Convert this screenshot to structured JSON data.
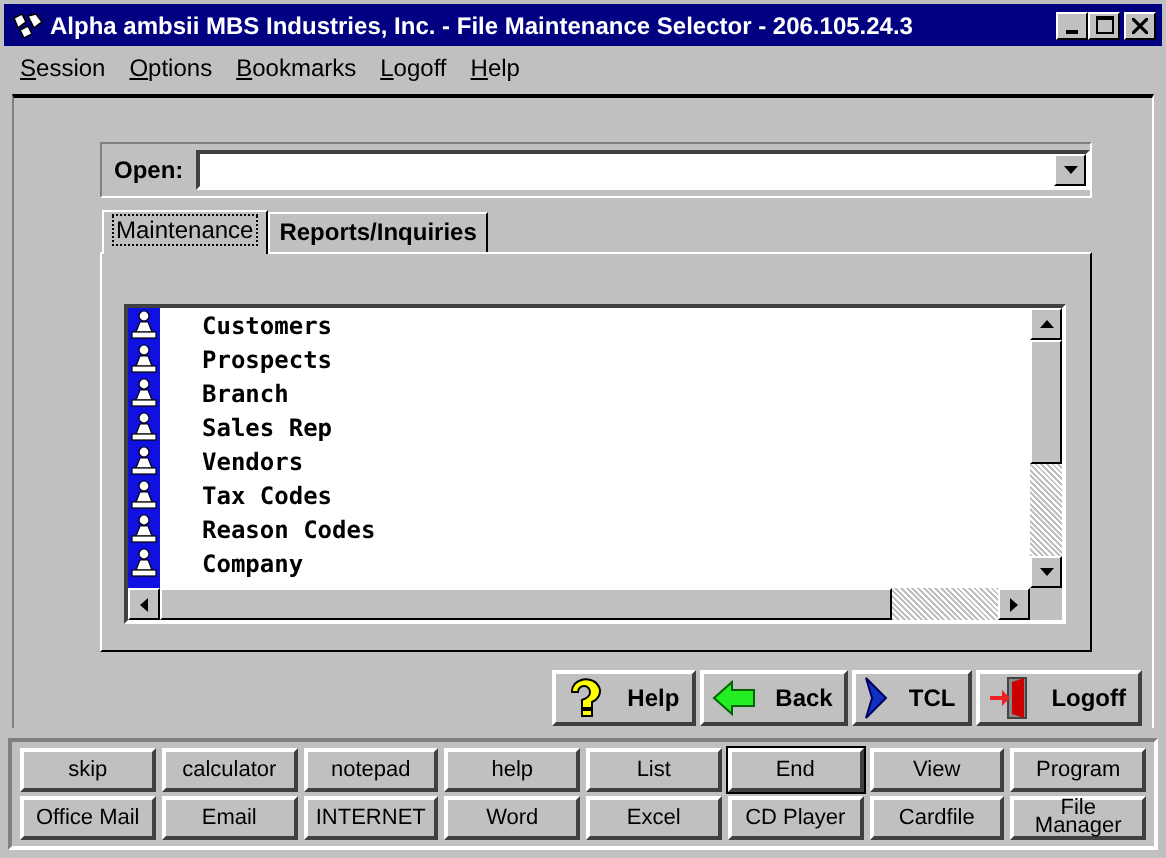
{
  "window": {
    "title": "Alpha ambsii MBS Industries, Inc. - File Maintenance Selector - 206.105.24.3"
  },
  "menu": [
    "Session",
    "Options",
    "Bookmarks",
    "Logoff",
    "Help"
  ],
  "open_field": {
    "label": "Open:"
  },
  "tabs": [
    {
      "label": "Maintenance",
      "selected": true
    },
    {
      "label": "Reports/Inquiries",
      "selected": false
    }
  ],
  "list_items": [
    "Customers",
    "Prospects",
    "Branch",
    "Sales Rep",
    "Vendors",
    "Tax Codes",
    "Reason Codes",
    "Company"
  ],
  "actions": [
    {
      "label": "Help",
      "kind": "help"
    },
    {
      "label": "Back",
      "kind": "back"
    },
    {
      "label": "TCL",
      "kind": "tcl"
    },
    {
      "label": "Logoff",
      "kind": "logoff"
    }
  ],
  "toolbar": [
    {
      "label": "skip",
      "default": false
    },
    {
      "label": "calculator",
      "default": false
    },
    {
      "label": "notepad",
      "default": false
    },
    {
      "label": "help",
      "default": false
    },
    {
      "label": "List",
      "default": false
    },
    {
      "label": "End",
      "default": true
    },
    {
      "label": "View",
      "default": false
    },
    {
      "label": "Program",
      "default": false
    },
    {
      "label": "Office Mail",
      "default": false
    },
    {
      "label": "Email",
      "default": false
    },
    {
      "label": "INTERNET",
      "default": false
    },
    {
      "label": "Word",
      "default": false
    },
    {
      "label": "Excel",
      "default": false
    },
    {
      "label": "CD Player",
      "default": false
    },
    {
      "label": "Cardfile",
      "default": false
    },
    {
      "label": "File Manager",
      "default": false
    }
  ]
}
